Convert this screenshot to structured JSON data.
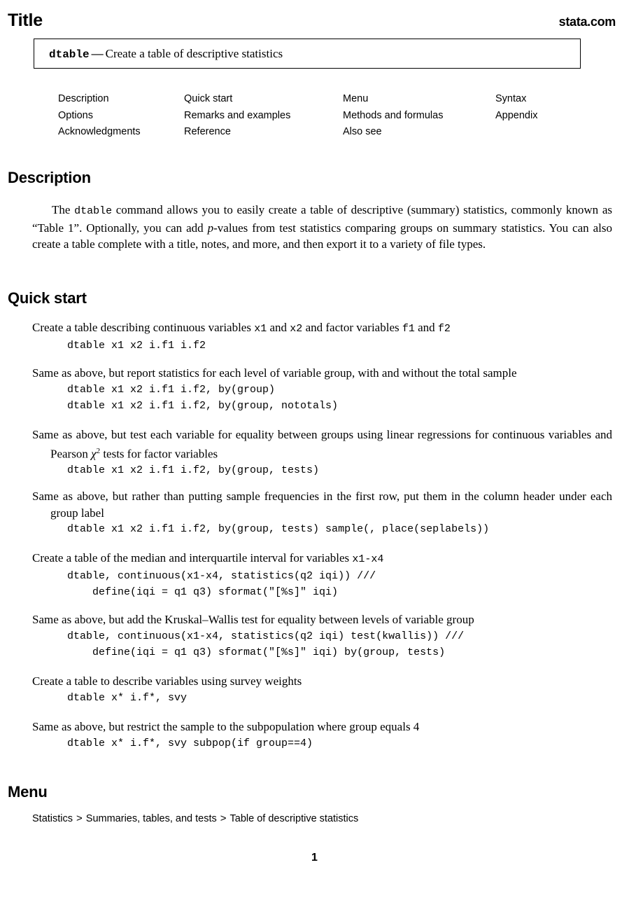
{
  "header": {
    "title": "Title",
    "site_mark": "stata.com"
  },
  "title_box": {
    "command": "dtable",
    "dash": "—",
    "description": "Create a table of descriptive statistics"
  },
  "toc": {
    "columns": [
      {
        "items": [
          "Description",
          "Options",
          "Acknowledgments"
        ]
      },
      {
        "items": [
          "Quick start",
          "Remarks and examples",
          "Reference"
        ]
      },
      {
        "items": [
          "Menu",
          "Methods and formulas",
          "Also see"
        ]
      },
      {
        "items": [
          "Syntax",
          "Appendix"
        ]
      }
    ]
  },
  "sections": {
    "description": {
      "heading": "Description",
      "paragraph_part1": "The ",
      "paragraph_cmd": "dtable",
      "paragraph_part2": " command allows you to easily create a table of descriptive (summary) statistics, commonly known as “Table 1”. Optionally, you can add ",
      "paragraph_pvar": "p",
      "paragraph_part3": "-values from test statistics comparing groups on summary statistics. You can also create a table complete with a title, notes, and more, and then export it to a variety of file types."
    },
    "quick_start": {
      "heading": "Quick start",
      "blocks": [
        {
          "text_pre": "Create a table describing continuous variables ",
          "v1": "x1",
          "text_mid1": " and ",
          "v2": "x2",
          "text_mid2": " and factor variables ",
          "v3": "f1",
          "text_mid3": " and ",
          "v4": "f2",
          "text_post": "",
          "code_lines": [
            "dtable x1 x2 i.f1 i.f2"
          ]
        },
        {
          "text": "Same as above, but report statistics for each level of variable group, with and without the total sample",
          "code_lines": [
            "dtable x1 x2 i.f1 i.f2, by(group)",
            "dtable x1 x2 i.f1 i.f2, by(group, nototals)"
          ]
        },
        {
          "text_pre": "Same as above, but test each variable for equality between groups using linear regressions for continuous variables and Pearson ",
          "chi": "χ",
          "chi_sup": "2",
          "text_post": " tests for factor variables",
          "code_lines": [
            "dtable x1 x2 i.f1 i.f2, by(group, tests)"
          ]
        },
        {
          "text": "Same as above, but rather than putting sample frequencies in the first row, put them in the column header under each group label",
          "code_lines": [
            "dtable x1 x2 i.f1 i.f2, by(group, tests) sample(, place(seplabels))"
          ]
        },
        {
          "text_pre": "Create a table of the median and interquartile interval for variables ",
          "v1": "x1-x4",
          "text_post": "",
          "code_lines": [
            "dtable, continuous(x1-x4, statistics(q2 iqi)) ///",
            "    define(iqi = q1 q3) sformat(\"[%s]\" iqi)"
          ]
        },
        {
          "text": "Same as above, but add the Kruskal–Wallis test for equality between levels of variable group",
          "code_lines": [
            "dtable, continuous(x1-x4, statistics(q2 iqi) test(kwallis)) ///",
            "    define(iqi = q1 q3) sformat(\"[%s]\" iqi) by(group, tests)"
          ]
        },
        {
          "text": "Create a table to describe variables using survey weights",
          "code_lines": [
            "dtable x* i.f*, svy"
          ]
        },
        {
          "text": "Same as above, but restrict the sample to the subpopulation where group equals 4",
          "code_lines": [
            "dtable x* i.f*, svy subpop(if group==4)"
          ]
        }
      ]
    },
    "menu": {
      "heading": "Menu",
      "path": [
        "Statistics",
        "Summaries, tables, and tests",
        "Table of descriptive statistics"
      ],
      "separator": ">"
    }
  },
  "footer": {
    "page_number": "1"
  }
}
